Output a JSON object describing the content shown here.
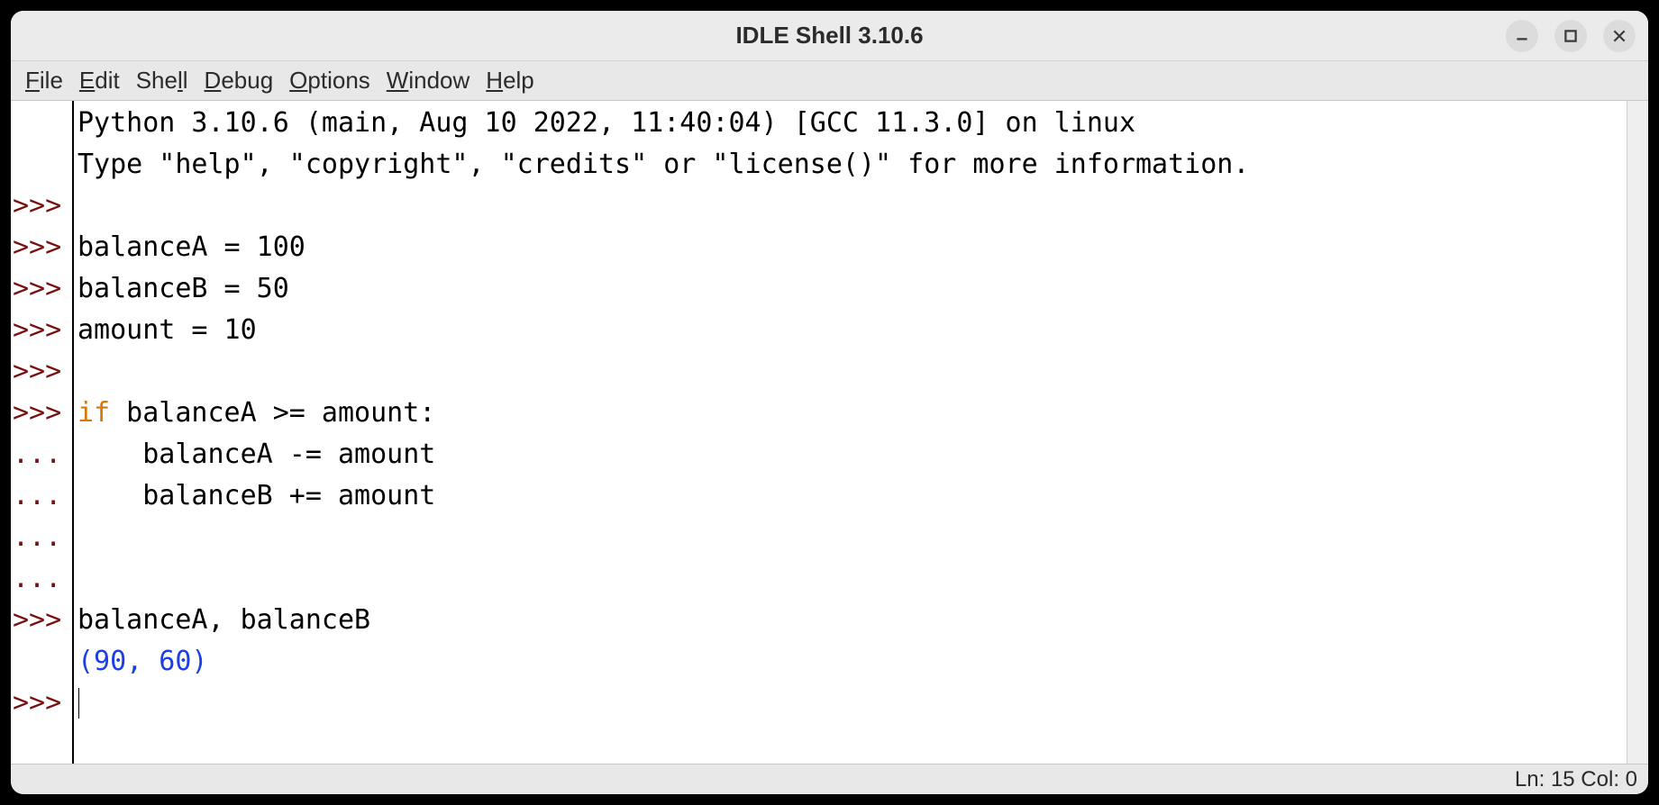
{
  "window": {
    "title": "IDLE Shell 3.10.6"
  },
  "menu": {
    "file": "File",
    "edit": "Edit",
    "shell": "Shell",
    "debug": "Debug",
    "options": "Options",
    "window": "Window",
    "help": "Help"
  },
  "gutter": {
    "lines": [
      "",
      "",
      ">>>",
      ">>>",
      ">>>",
      ">>>",
      ">>>",
      ">>>",
      "...",
      "...",
      "...",
      "...",
      ">>>",
      "",
      ">>>"
    ]
  },
  "code": {
    "banner1": "Python 3.10.6 (main, Aug 10 2022, 11:40:04) [GCC 11.3.0] on linux",
    "banner2": "Type \"help\", \"copyright\", \"credits\" or \"license()\" for more information.",
    "blank": "",
    "l_balanceA": "balanceA = 100",
    "l_balanceB": "balanceB = 50",
    "l_amount": "amount = 10",
    "if_kw": "if",
    "if_rest": " balanceA >= amount:",
    "if_body1": "    balanceA -= amount",
    "if_body2": "    balanceB += amount",
    "l_query": "balanceA, balanceB",
    "l_output": "(90, 60)"
  },
  "status": {
    "lncol": "Ln: 15 Col: 0"
  }
}
